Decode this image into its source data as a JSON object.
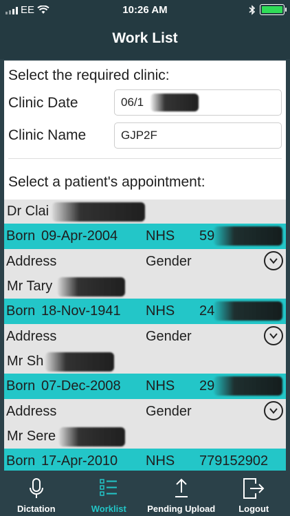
{
  "status": {
    "carrier": "EE",
    "time": "10:26 AM"
  },
  "nav": {
    "title": "Work List"
  },
  "clinic": {
    "heading": "Select the required clinic:",
    "date_label": "Clinic Date",
    "date_value": "06/1",
    "name_label": "Clinic Name",
    "name_value": "GJP2F"
  },
  "patients_heading": "Select a patient's appointment:",
  "patients": [
    {
      "name": "Dr Clai",
      "born_label": "Born",
      "born": "09-Apr-2004",
      "nhs_label": "NHS",
      "nhs": "59",
      "address_label": "Address",
      "gender_label": "Gender"
    },
    {
      "name": "Mr Tary",
      "born_label": "Born",
      "born": "18-Nov-1941",
      "nhs_label": "NHS",
      "nhs": "24",
      "address_label": "Address",
      "gender_label": "Gender"
    },
    {
      "name": "Mr Sh",
      "born_label": "Born",
      "born": "07-Dec-2008",
      "nhs_label": "NHS",
      "nhs": "29",
      "address_label": "Address",
      "gender_label": "Gender"
    },
    {
      "name": "Mr Sere",
      "born_label": "Born",
      "born": "17-Apr-2010",
      "nhs_label": "NHS",
      "nhs": "779152902",
      "address_label": "Address",
      "gender_label": "Gender"
    }
  ],
  "tabs": [
    {
      "label": "Dictation",
      "icon": "microphone-icon"
    },
    {
      "label": "Worklist",
      "icon": "list-icon",
      "active": true
    },
    {
      "label": "Pending Upload",
      "icon": "upload-icon"
    },
    {
      "label": "Logout",
      "icon": "logout-icon"
    }
  ],
  "colors": {
    "accent": "#23c6c8",
    "bar": "#2b4149",
    "row_gray": "#e4e4e4"
  }
}
